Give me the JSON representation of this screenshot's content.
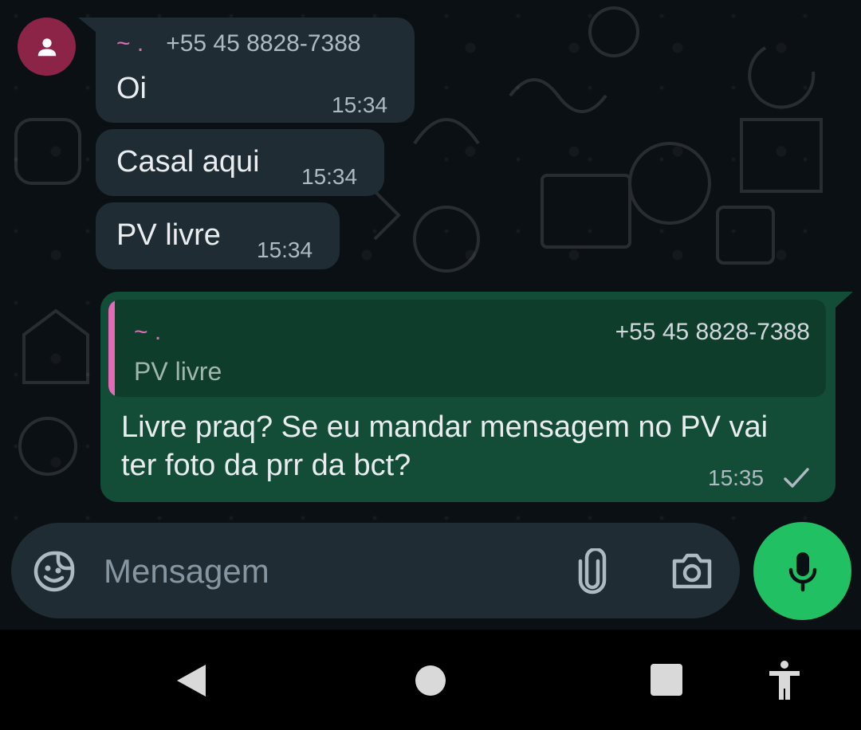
{
  "chat": {
    "sender": {
      "name": "~ .",
      "phone": "+55 45 8828-7388",
      "avatar_icon": "person-icon",
      "avatar_color": "#8c2448"
    },
    "incoming": [
      {
        "text": "Oi",
        "time": "15:34"
      },
      {
        "text": "Casal aqui",
        "time": "15:34"
      },
      {
        "text": "PV livre",
        "time": "15:34"
      }
    ],
    "outgoing": {
      "quote": {
        "name": "~ .",
        "phone": "+55 45 8828-7388",
        "text": "PV livre"
      },
      "text": "Livre praq? Se eu mandar mensagem no PV vai ter foto da prr da bct?",
      "time": "15:35",
      "status_icon": "single-check-icon"
    }
  },
  "composer": {
    "placeholder": "Mensagem",
    "icons": [
      "sticker-icon",
      "paperclip-icon",
      "camera-icon",
      "microphone-icon"
    ]
  },
  "navbar": {
    "icons": [
      "back-icon",
      "home-icon",
      "recents-icon",
      "accessibility-icon"
    ]
  },
  "colors": {
    "background": "#0b1014",
    "incoming_bubble": "#1f2c33",
    "outgoing_bubble": "#134d37",
    "accent_green": "#21c063",
    "sender_pink": "#e26ab6"
  }
}
